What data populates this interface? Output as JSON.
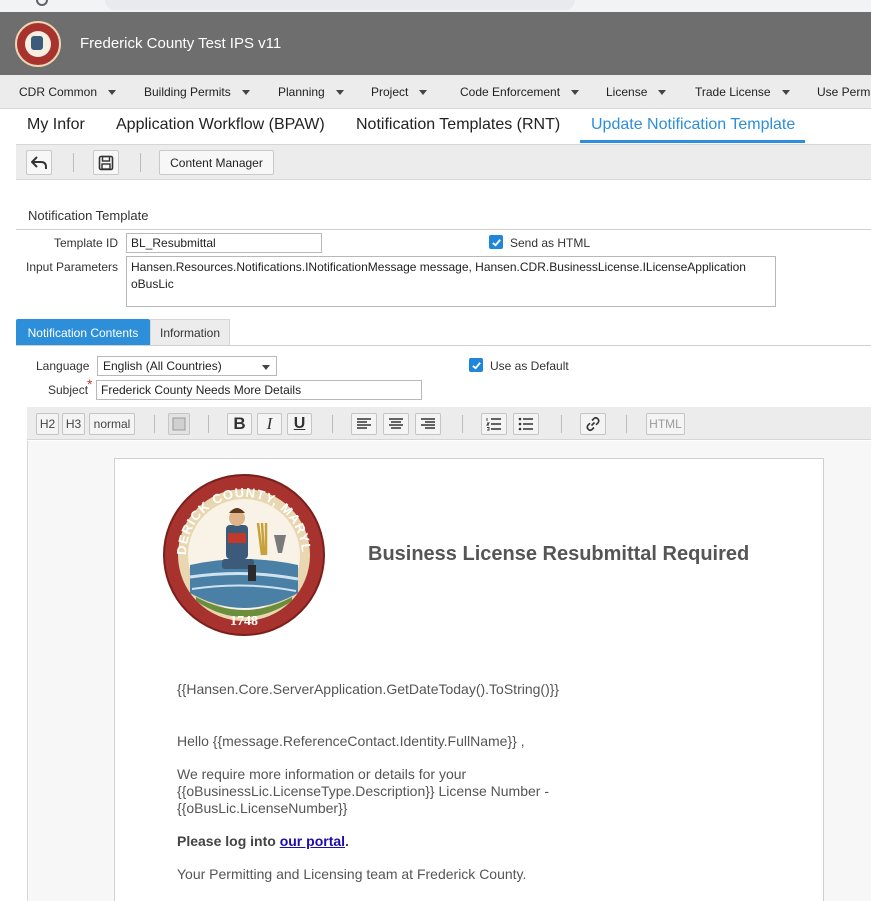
{
  "app": {
    "title": "Frederick County Test IPS v11",
    "logo_icon": "county-seal-icon"
  },
  "menu": {
    "items": [
      {
        "label": "CDR Common"
      },
      {
        "label": "Building Permits"
      },
      {
        "label": "Planning"
      },
      {
        "label": "Project"
      },
      {
        "label": "Code Enforcement"
      },
      {
        "label": "License"
      },
      {
        "label": "Trade License"
      },
      {
        "label": "Use Perm"
      }
    ]
  },
  "tabs": [
    {
      "label": "My Infor"
    },
    {
      "label": "Application Workflow (BPAW)"
    },
    {
      "label": "Notification Templates (RNT)"
    },
    {
      "label": "Update Notification Template",
      "active": true
    }
  ],
  "toolbar": {
    "content_manager_label": "Content Manager",
    "undo_icon": "undo-icon",
    "save_icon": "save-icon"
  },
  "form": {
    "section_title": "Notification Template",
    "template_id_label": "Template ID",
    "template_id_value": "BL_Resubmittal",
    "send_as_html_label": "Send as HTML",
    "send_as_html_checked": true,
    "input_parameters_label": "Input Parameters",
    "input_parameters_value": "Hansen.Resources.Notifications.INotificationMessage message,  Hansen.CDR.BusinessLicense.ILicenseApplication oBusLic"
  },
  "content_tabs": {
    "notification_contents": "Notification Contents",
    "information": "Information"
  },
  "contents": {
    "language_label": "Language",
    "language_value": "English (All Countries)",
    "use_as_default_label": "Use as Default",
    "use_as_default_checked": true,
    "subject_label": "Subject",
    "required_mark": "*",
    "subject_value": "Frederick County Needs More Details"
  },
  "editor_toolbar": {
    "h2": "H2",
    "h3": "H3",
    "normal": "normal",
    "html": "HTML",
    "bold": "B",
    "italic": "I",
    "underline": "U"
  },
  "email": {
    "seal_top_text": "FREDERICK COUNTY, MARYLAND",
    "seal_year": "1748",
    "heading": "Business License Resubmittal Required",
    "date_line": "{{Hansen.Core.ServerApplication.GetDateToday().ToString()}}",
    "greeting": "Hello {{message.ReferenceContact.Identity.FullName}} ,",
    "body_line1": "We require more information or details for your",
    "body_line2": "{{oBusinessLic.LicenseType.Description}} License Number -",
    "body_line3": "{{oBusLic.LicenseNumber}}",
    "login_prefix": "Please log into ",
    "login_link": "our portal",
    "login_suffix": ".",
    "signoff": "Your Permitting and Licensing team at Frederick County."
  },
  "colors": {
    "accent": "#2d8fd9",
    "titlebar": "#6e6e6e",
    "seal_red": "#a8322e"
  }
}
